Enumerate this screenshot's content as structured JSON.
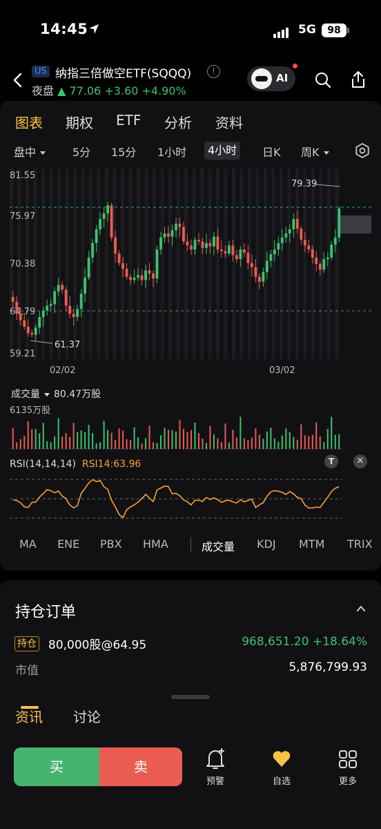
{
  "status": {
    "time": "14:45",
    "network": "5G",
    "battery": "98"
  },
  "header": {
    "market_badge": "US",
    "title": "纳指三倍做空ETF(SQQQ)",
    "session": "夜盘",
    "price_line": "▲ 77.06 +3.60 +4.90%",
    "ai_label": "AI"
  },
  "tabs_main": [
    "图表",
    "期权",
    "ETF",
    "分析",
    "资料"
  ],
  "tabs_period": [
    "盘中",
    "5分",
    "15分",
    "1小时",
    "4小时",
    "日K",
    "周K"
  ],
  "chart_labels": {
    "y_ticks": [
      "81.55",
      "75.97",
      "70.38",
      "64.79",
      "59.21"
    ],
    "x_ticks": [
      "02/02",
      "03/02"
    ],
    "high_label": "79.39",
    "low_label": "61.37"
  },
  "volume": {
    "label": "成交量",
    "value": "80.47万股",
    "max": "6135万股"
  },
  "rsi": {
    "label": "RSI(14,14,14)",
    "value": "RSI14:63.96"
  },
  "indicators": [
    "MA",
    "ENE",
    "PBX",
    "HMA",
    "成交量",
    "KDJ",
    "MTM",
    "TRIX"
  ],
  "position": {
    "title": "持仓订单",
    "badge": "持仓",
    "detail": "80,000股@64.95",
    "pnl": "968,651.20  +18.64%",
    "mv_label": "市值",
    "mv_value": "5,876,799.93"
  },
  "news_tabs": [
    "资讯",
    "讨论"
  ],
  "bottom": {
    "buy": "买",
    "sell": "卖",
    "alert": "预警",
    "watch": "自选",
    "more": "更多"
  },
  "chart_data": {
    "type": "candlestick",
    "title": "",
    "y_range": [
      59.21,
      81.55
    ],
    "x_tick_labels": [
      "02/02",
      "03/02"
    ],
    "closes": [
      65.5,
      64.0,
      63.2,
      62.4,
      61.6,
      61.4,
      62.3,
      63.6,
      64.4,
      65.0,
      65.2,
      66.8,
      67.6,
      67.0,
      65.0,
      64.0,
      63.6,
      64.6,
      66.5,
      68.5,
      71.0,
      72.8,
      74.5,
      75.8,
      76.5,
      77.5,
      73.5,
      71.5,
      70.3,
      69.6,
      68.6,
      68.2,
      68.5,
      68.8,
      68.2,
      69.4,
      69.0,
      68.4,
      72.0,
      73.5,
      74.0,
      73.6,
      74.4,
      75.2,
      74.8,
      73.0,
      72.5,
      72.0,
      73.2,
      73.0,
      72.2,
      72.8,
      72.4,
      73.6,
      72.0,
      71.8,
      71.5,
      72.5,
      71.3,
      70.8,
      72.0,
      71.6,
      70.3,
      69.8,
      68.6,
      68.0,
      69.2,
      70.6,
      71.4,
      72.0,
      72.8,
      73.5,
      74.0,
      74.5,
      75.8,
      74.6,
      73.2,
      72.5,
      72.0,
      71.0,
      70.2,
      69.5,
      70.8,
      71.0,
      72.6,
      73.5,
      77.1
    ],
    "volume_max_label": "6135万股",
    "rsi_value": 63.96
  }
}
